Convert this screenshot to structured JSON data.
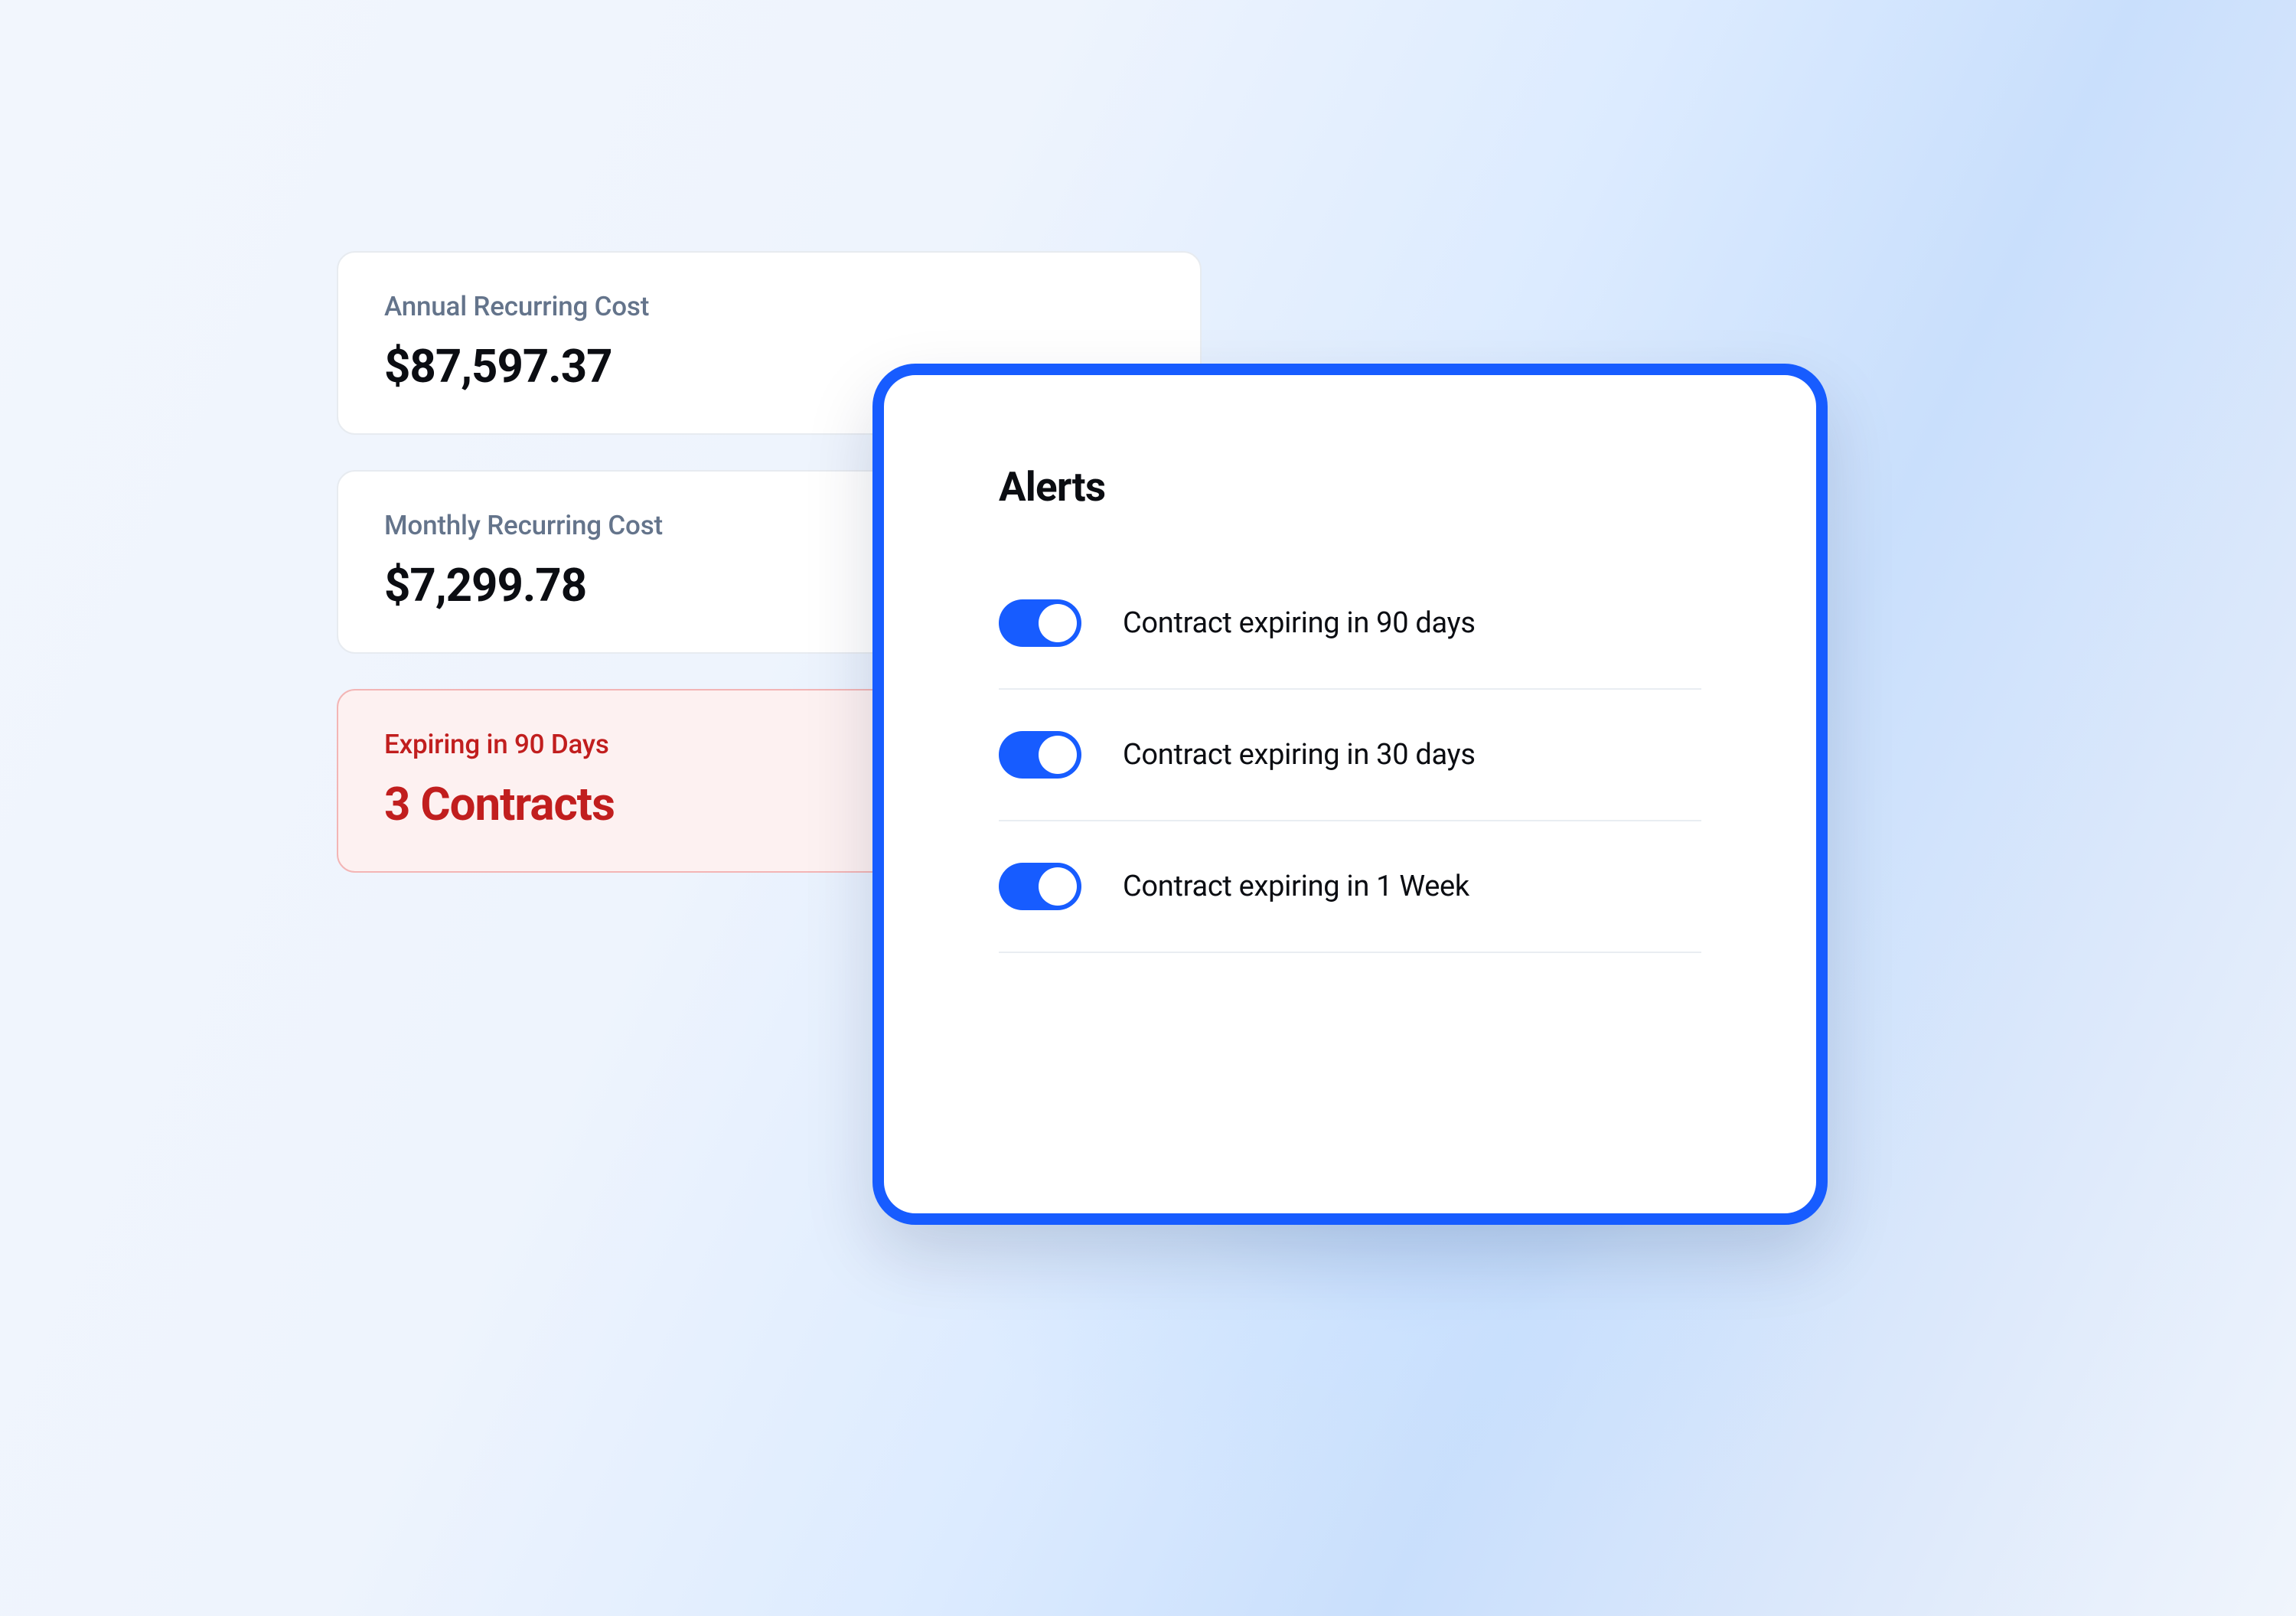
{
  "metrics": {
    "annual": {
      "label": "Annual Recurring Cost",
      "value": "$87,597.37"
    },
    "monthly": {
      "label": "Monthly Recurring Cost",
      "value": "$7,299.78"
    },
    "expiring": {
      "label": "Expiring in 90 Days",
      "value": "3 Contracts"
    }
  },
  "alerts": {
    "title": "Alerts",
    "items": [
      {
        "label": "Contract expiring in 90 days",
        "on": true
      },
      {
        "label": "Contract expiring in 30 days",
        "on": true
      },
      {
        "label": "Contract expiring in 1 Week",
        "on": true
      }
    ]
  }
}
